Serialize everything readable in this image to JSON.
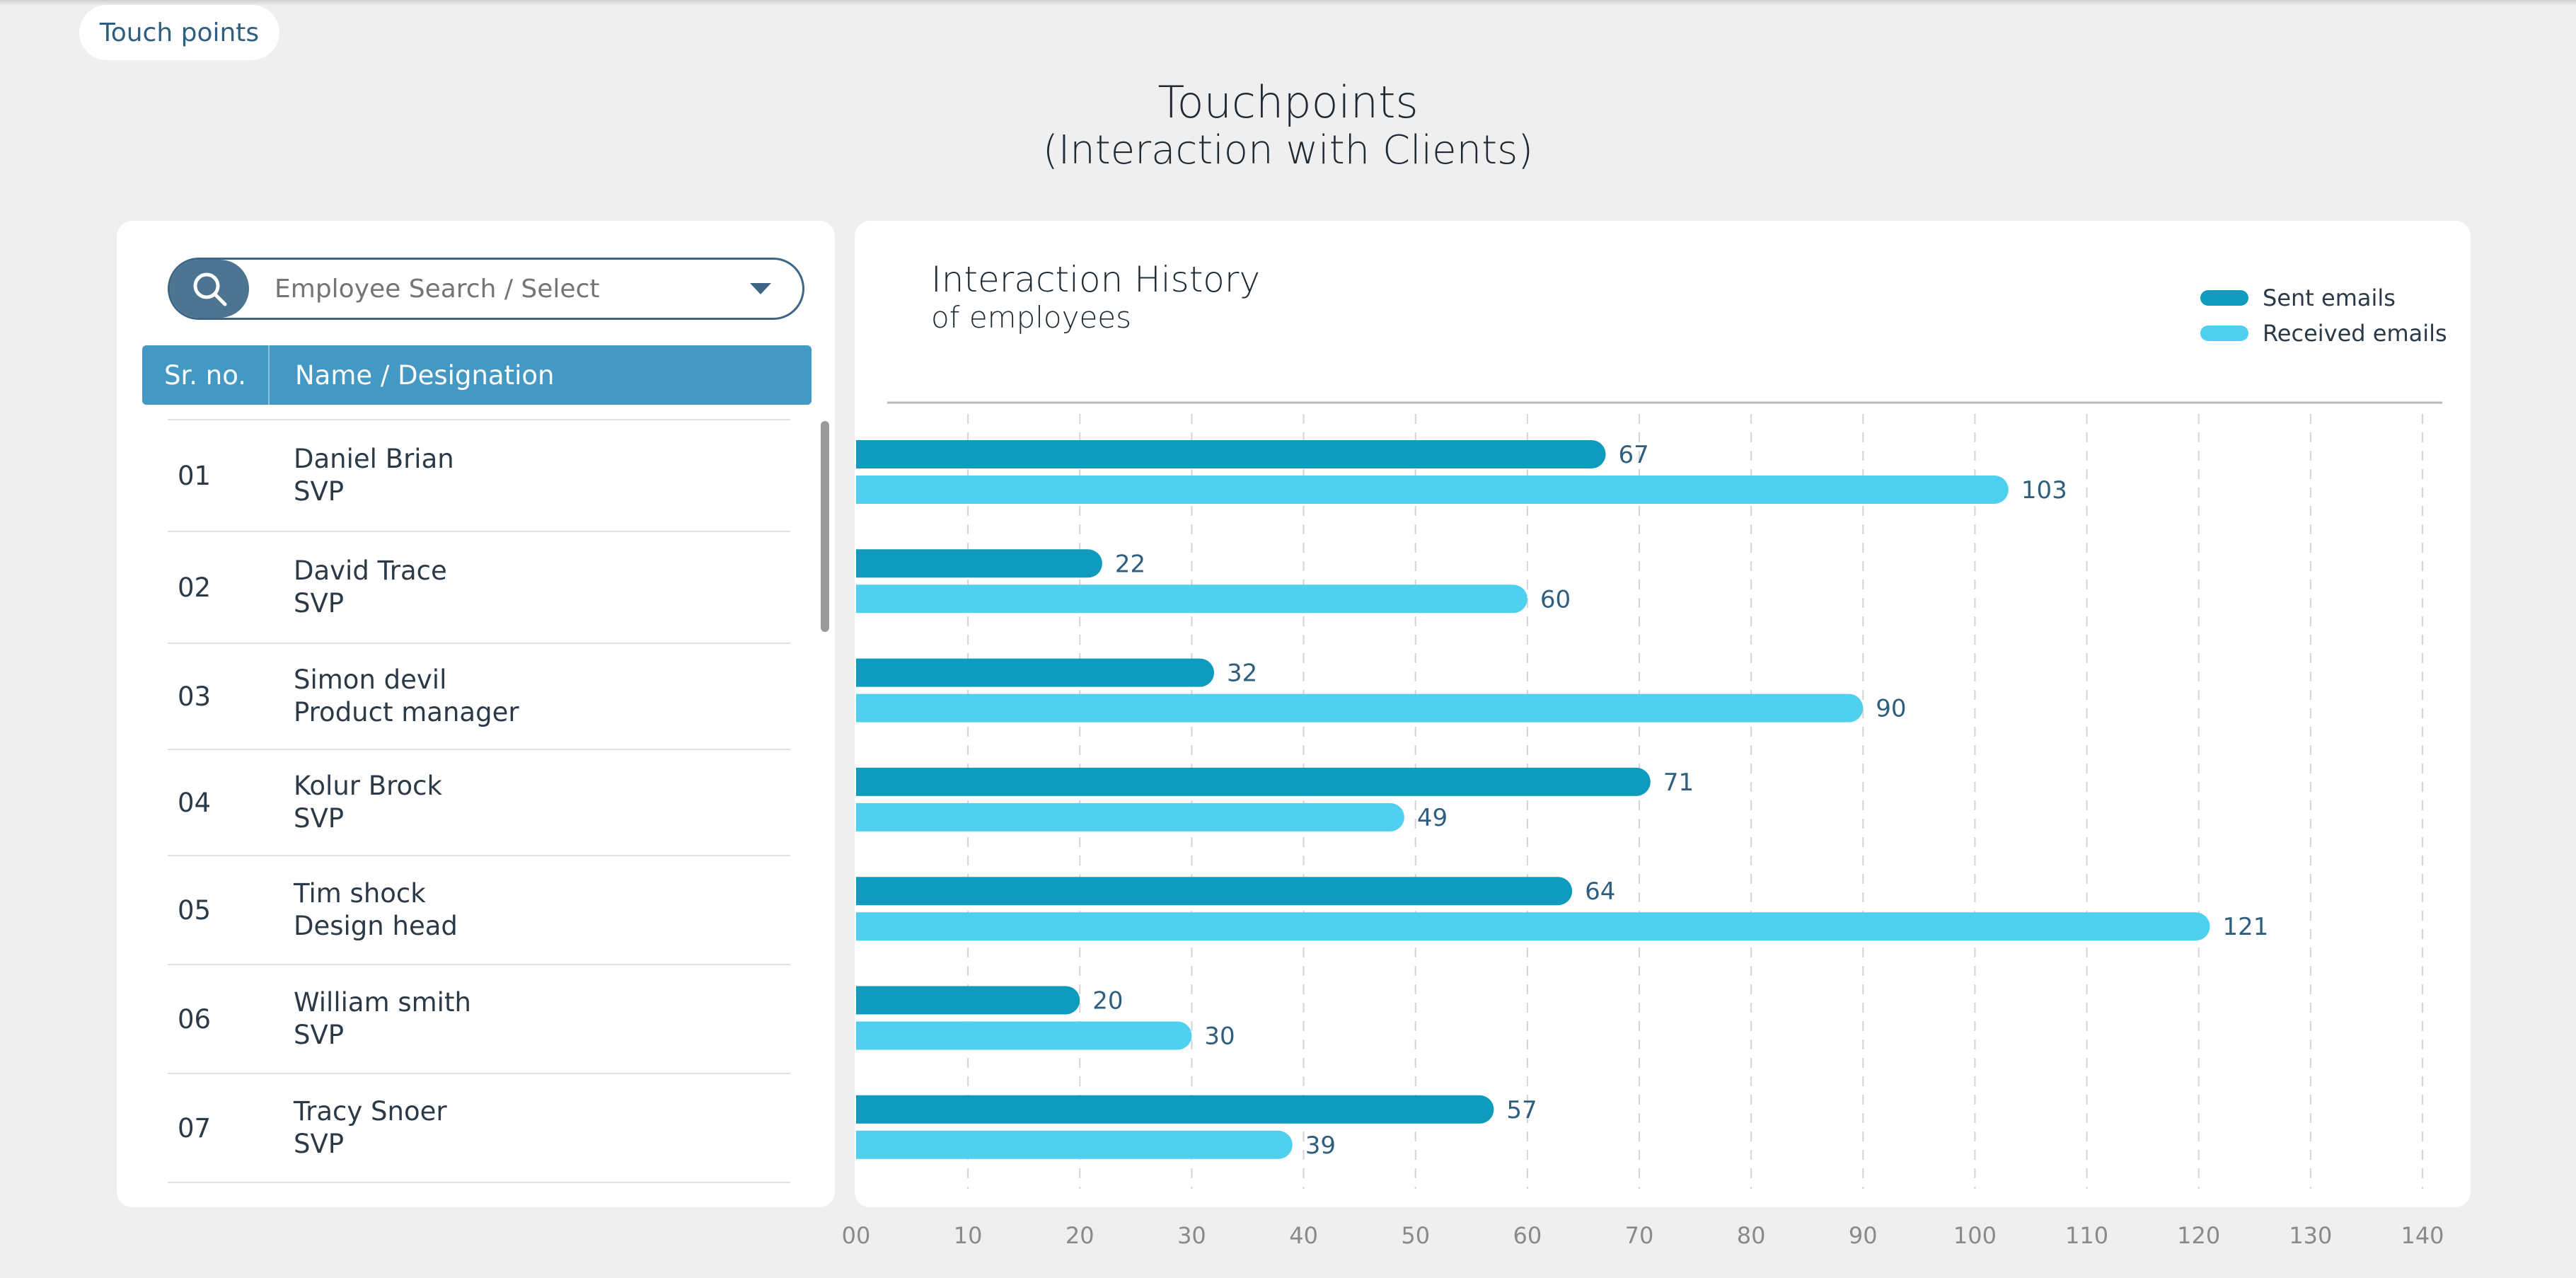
{
  "header": {
    "nav_label": "Touch points"
  },
  "page": {
    "title": "Touchpoints",
    "subtitle": "(Interaction with Clients)"
  },
  "employee_panel": {
    "search": {
      "placeholder": "Employee Search / Select"
    },
    "columns": {
      "sr": "Sr. no.",
      "name": "Name / Designation"
    },
    "rows": [
      {
        "sr": "01",
        "name": "Daniel Brian",
        "designation": "SVP"
      },
      {
        "sr": "02",
        "name": "David Trace",
        "designation": "SVP"
      },
      {
        "sr": "03",
        "name": "Simon devil",
        "designation": "Product manager"
      },
      {
        "sr": "04",
        "name": "Kolur Brock",
        "designation": "SVP"
      },
      {
        "sr": "05",
        "name": "Tim shock",
        "designation": "Design head"
      },
      {
        "sr": "06",
        "name": "William smith",
        "designation": "SVP"
      },
      {
        "sr": "07",
        "name": "Tracy Snoer",
        "designation": "SVP"
      }
    ]
  },
  "chart_data": {
    "type": "bar",
    "orientation": "horizontal",
    "title": "Interaction History",
    "subtitle": "of employees",
    "categories": [
      "01",
      "02",
      "03",
      "04",
      "05",
      "06",
      "07"
    ],
    "series": [
      {
        "name": "Sent emails",
        "color": "#0f9bbd",
        "values": [
          67,
          22,
          32,
          71,
          64,
          20,
          57
        ]
      },
      {
        "name": "Received emails",
        "color": "#4fd0ee",
        "values": [
          103,
          60,
          90,
          49,
          121,
          30,
          39
        ]
      }
    ],
    "x_ticks": [
      "00",
      "10",
      "20",
      "30",
      "40",
      "50",
      "60",
      "70",
      "80",
      "90",
      "100",
      "110",
      "120",
      "130",
      "140"
    ],
    "xlim": [
      0,
      140
    ],
    "grid": true,
    "legend_position": "top-right"
  },
  "icons": {
    "search": "search-icon",
    "dropdown": "chevron-down-icon"
  }
}
